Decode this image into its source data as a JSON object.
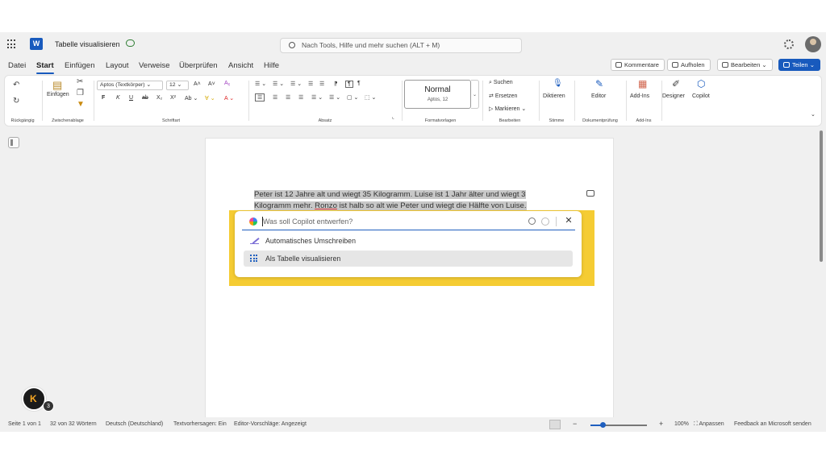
{
  "titlebar": {
    "app_icon": "word-icon",
    "app_letter": "W",
    "doc_title": "Tabelle visualisieren",
    "search_placeholder": "Nach Tools, Hilfe und mehr suchen (ALT + M)"
  },
  "menu": {
    "tabs": [
      "Datei",
      "Start",
      "Einfügen",
      "Layout",
      "Verweise",
      "Überprüfen",
      "Ansicht",
      "Hilfe"
    ],
    "active_tab": "Start",
    "right_buttons": {
      "comments": "Kommentare",
      "catchup": "Aufholen",
      "edit": "Bearbeiten",
      "share": "Teilen"
    }
  },
  "ribbon": {
    "undo_group": "Rückgängig",
    "clipboard": {
      "paste": "Einfügen",
      "label": "Zwischenablage"
    },
    "font": {
      "name": "Aptos (Textkörper)",
      "size": "12",
      "label": "Schriftart"
    },
    "paragraph": {
      "label": "Absatz"
    },
    "styles": {
      "current": "Normal",
      "sub": "Aptos, 12",
      "label": "Formatvorlagen"
    },
    "editing": {
      "find": "Suchen",
      "replace": "Ersetzen",
      "select": "Markieren",
      "label": "Bearbeiten"
    },
    "voice": {
      "dictate": "Diktieren",
      "label": "Stimme"
    },
    "review": {
      "editor": "Editor",
      "label": "Dokumentprüfung"
    },
    "addins": {
      "addins": "Add-Ins",
      "label": "Add-Ins"
    },
    "designer": "Designer",
    "copilot": "Copilot"
  },
  "document": {
    "line1": "Peter ist 12 Jahre alt und wiegt 35 Kilogramm. Luise ist 1 Jahr älter und wiegt 3",
    "line2_a": "Kilogramm mehr. ",
    "line2_name": "Ronzo",
    "line2_b": " ist halb so alt wie Peter und wiegt die Hälfte von Luise."
  },
  "copilot": {
    "placeholder": "Was soll Copilot entwerfen?",
    "options": [
      {
        "label": "Automatisches Umschreiben",
        "icon": "rewrite-pen-icon"
      },
      {
        "label": "Als Tabelle visualisieren",
        "icon": "table-grid-icon",
        "selected": true
      }
    ]
  },
  "badge_count": "3",
  "statusbar": {
    "page": "Seite 1 von 1",
    "words": "32 von 32 Wörtern",
    "language": "Deutsch (Deutschland)",
    "predictions": "Textvorhersagen: Ein",
    "editor_suggestions": "Editor-Vorschläge: Angezeigt",
    "zoom_minus": "−",
    "zoom_plus": "+",
    "zoom": "100%",
    "fit": "Anpassen",
    "feedback": "Feedback an Microsoft senden"
  },
  "colors": {
    "accent": "#185abd",
    "highlight_frame": "#f5cc33",
    "selection": "#c8c8c8"
  }
}
